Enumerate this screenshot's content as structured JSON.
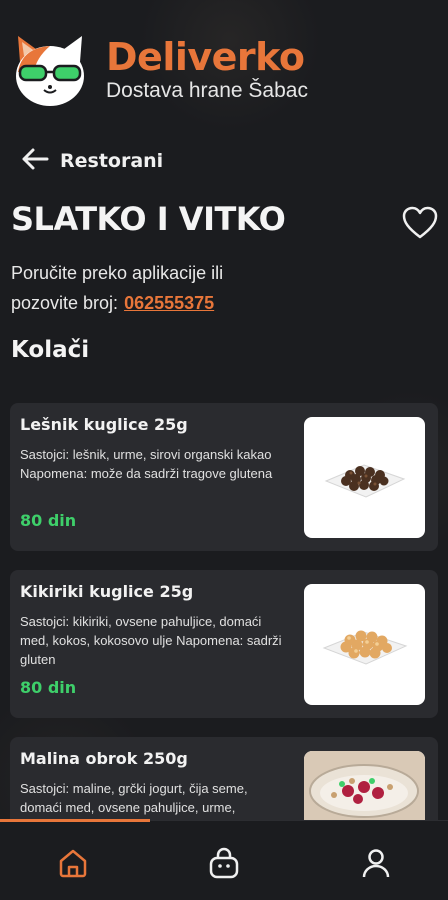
{
  "brand": {
    "title": "Deliverko",
    "subtitle": "Dostava hrane Šabac",
    "accent": "#e8763a"
  },
  "nav": {
    "back_label": "Restorani"
  },
  "restaurant": {
    "name": "SLATKO I VITKO",
    "order_line1": "Poručite preko aplikacije ili",
    "order_line2": "pozovite broj:",
    "phone": "062555375"
  },
  "section_title": "Kolači",
  "items": [
    {
      "name": "Lešnik kuglice 25g",
      "description": "Sastojci: lešnik, urme, sirovi organski kakao Napomena: može da sadrži tragove glutena",
      "price": "80 din",
      "image_icon": "hazelnut-balls-photo"
    },
    {
      "name": "Kikiriki kuglice 25g",
      "description": "Sastojci: kikiriki, ovsene pahuljice, domaći med, kokos, kokosovo ulje Napomena: sadrži gluten",
      "price": "80 din",
      "image_icon": "peanut-balls-photo"
    },
    {
      "name": "Malina obrok 250g",
      "description": "Sastojci: maline, grčki jogurt, čija seme, domaći med, ovsene pahuljice, urme,",
      "price": "",
      "image_icon": "raspberry-bowl-photo"
    }
  ],
  "bottom_nav": {
    "active": "home",
    "items": [
      "home-icon",
      "cart-bag-icon",
      "profile-icon"
    ],
    "price_color": "#3ecf6a"
  }
}
